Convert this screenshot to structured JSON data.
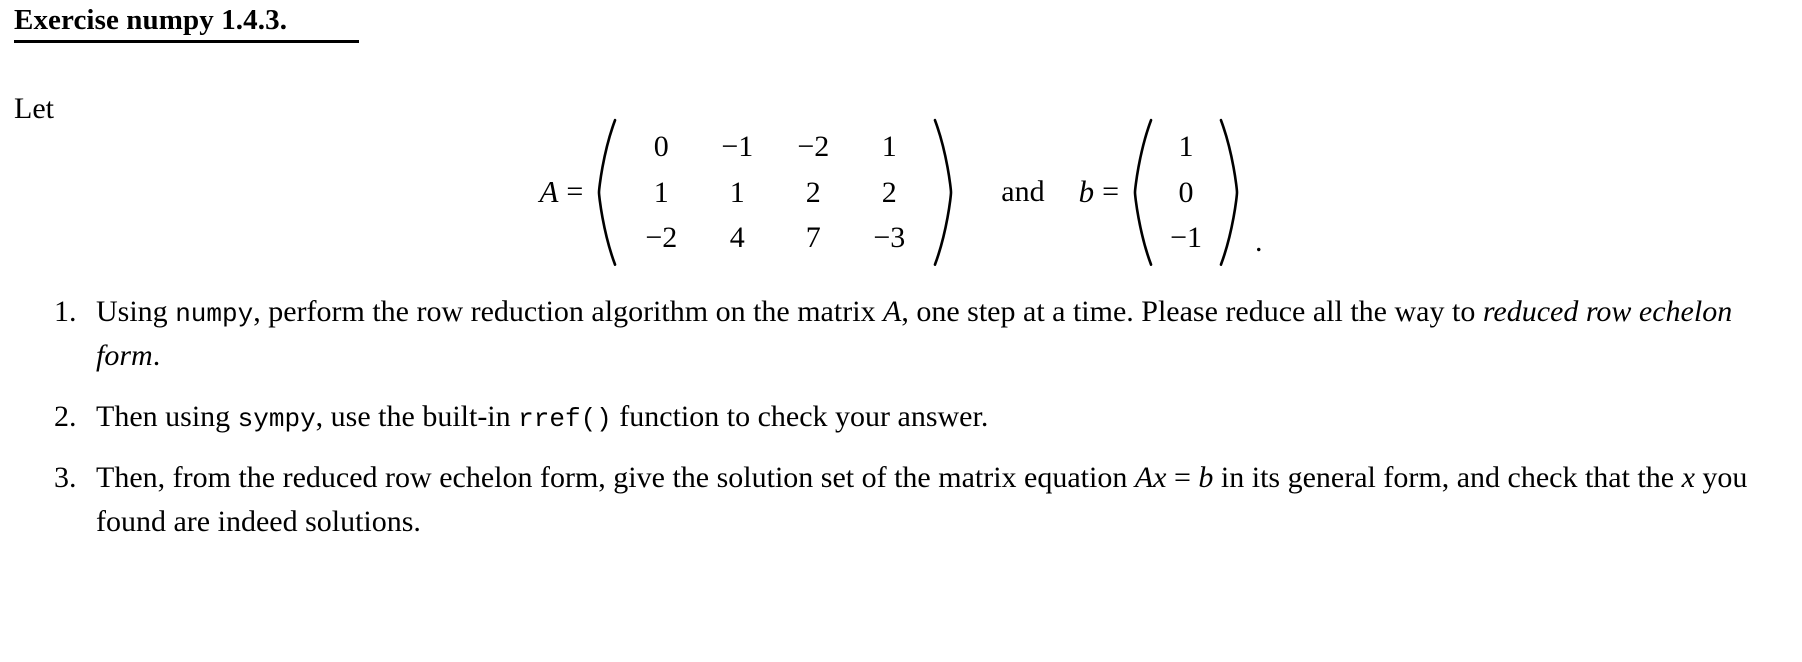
{
  "document": {
    "title": "Exercise numpy 1.4.3.",
    "lead": "Let"
  },
  "equation": {
    "matrix_label": "A",
    "equals": "=",
    "conjunction": "and",
    "vector_label": "b",
    "trailing_punctuation": ".",
    "matrix_A": [
      [
        "0",
        "−1",
        "−2",
        "1"
      ],
      [
        "1",
        "1",
        "2",
        "2"
      ],
      [
        "−2",
        "4",
        "7",
        "−3"
      ]
    ],
    "vector_b": [
      [
        "1"
      ],
      [
        "0"
      ],
      [
        "−1"
      ]
    ]
  },
  "items": [
    {
      "number": "1.",
      "parts": [
        {
          "type": "text",
          "value": "Using "
        },
        {
          "type": "mono",
          "value": "numpy"
        },
        {
          "type": "text",
          "value": ", perform the row reduction algorithm on the matrix "
        },
        {
          "type": "math",
          "value": "A"
        },
        {
          "type": "text",
          "value": ", one step at a time. Please reduce all the way to "
        },
        {
          "type": "italic",
          "value": "reduced row echelon form"
        },
        {
          "type": "text",
          "value": "."
        }
      ]
    },
    {
      "number": "2.",
      "parts": [
        {
          "type": "text",
          "value": "Then using "
        },
        {
          "type": "mono",
          "value": "sympy"
        },
        {
          "type": "text",
          "value": ", use the built-in "
        },
        {
          "type": "mono",
          "value": "rref()"
        },
        {
          "type": "text",
          "value": " function to check your answer."
        }
      ]
    },
    {
      "number": "3.",
      "parts": [
        {
          "type": "text",
          "value": "Then, from the reduced row echelon form, give the solution set of the matrix equation "
        },
        {
          "type": "math",
          "value": "Ax"
        },
        {
          "type": "text",
          "value": " = "
        },
        {
          "type": "math",
          "value": "b"
        },
        {
          "type": "text",
          "value": " in its general form, and check that the "
        },
        {
          "type": "math",
          "value": "x"
        },
        {
          "type": "text",
          "value": " you found are indeed solutions."
        }
      ]
    }
  ],
  "colors": {
    "text": "#000000",
    "background": "#ffffff"
  }
}
